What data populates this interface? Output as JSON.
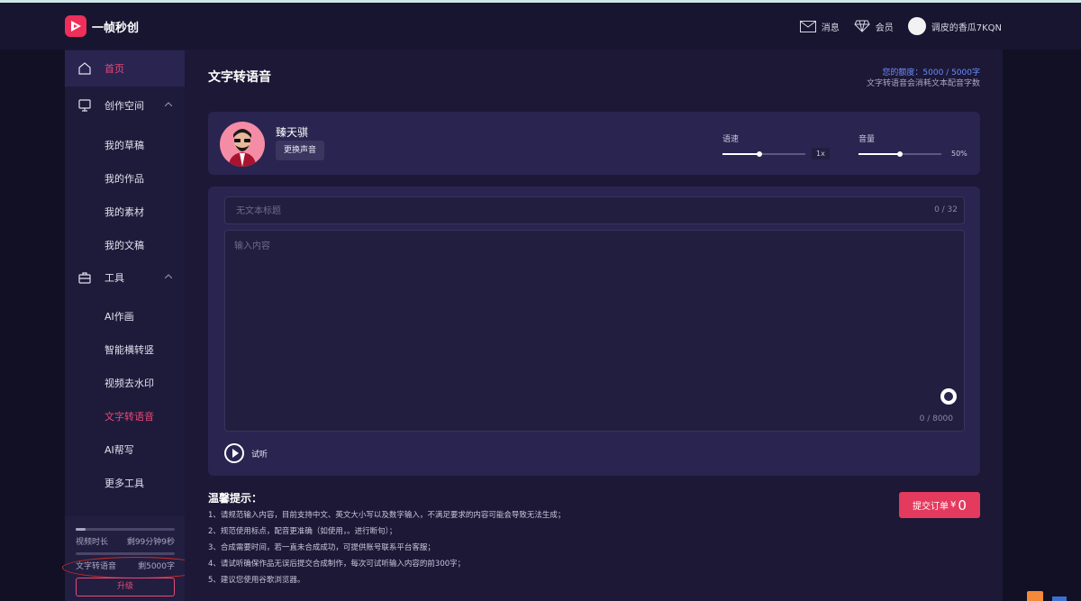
{
  "app": {
    "name": "一帧秒创"
  },
  "header": {
    "messages_label": "消息",
    "vip_label": "会员",
    "username": "调皮的香瓜7KQN"
  },
  "sidebar": {
    "home": "首页",
    "create_space": "创作空间",
    "create_items": [
      "我的草稿",
      "我的作品",
      "我的素材",
      "我的文稿"
    ],
    "tools": "工具",
    "tool_items": [
      "AI作画",
      "智能横转竖",
      "视频去水印",
      "文字转语音",
      "AI帮写",
      "更多工具"
    ],
    "active_tool": "文字转语音",
    "quota": {
      "video_label": "视频时长",
      "video_remaining": "剩99分钟9秒",
      "video_fraction": 0.1,
      "tts_label": "文字转语音",
      "tts_remaining": "剩5000字",
      "tts_fraction": 0
    },
    "upgrade_label": "升级"
  },
  "main": {
    "title": "文字转语音",
    "quota_line1": "您的额度：5000 / 5000字",
    "quota_line2": "文字转语音会消耗文本配音字数",
    "voice": {
      "name": "臻天骐",
      "change_button": "更换声音",
      "speed_label": "语速",
      "speed_value": "1x",
      "speed_fraction": 0.45,
      "volume_label": "音量",
      "volume_value": "50%",
      "volume_fraction": 0.5
    },
    "editor": {
      "title_placeholder": "无文本标题",
      "title_counter": "0 / 32",
      "content_placeholder": "输入内容",
      "content_counter": "0 / 8000",
      "listen_label": "试听"
    },
    "tips": {
      "title": "温馨提示：",
      "items": [
        "1、请规范输入内容，目前支持中文、英文大小写以及数字输入，不满足要求的内容可能会导致无法生成；",
        "2、规范使用标点，配音更准确（如使用，。进行断句）；",
        "3、合成需要时间，若一直未合成成功，可提供账号联系平台客服；",
        "4、请试听确保作品无误后提交合成制作，每次可试听输入内容的前300字；",
        "5、建议您使用谷歌浏览器。"
      ]
    },
    "submit": {
      "label": "提交订单",
      "currency": "¥",
      "price": "0"
    }
  },
  "colors": {
    "accent": "#e33a5e",
    "active_text": "#e64a78",
    "link_blue": "#6b8cff"
  }
}
